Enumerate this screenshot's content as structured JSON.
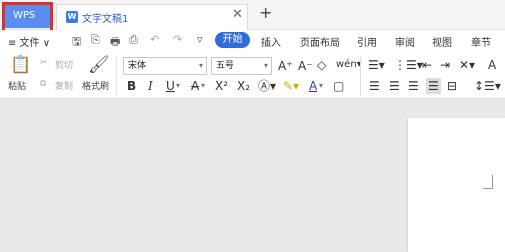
{
  "tabs": {
    "wps_label": "WPS",
    "doc_icon_letter": "W",
    "doc_title": "文字文稿1",
    "close_glyph": "✕",
    "new_tab_glyph": "+"
  },
  "menu": {
    "file_label": "≡ 文件 ∨",
    "quick_access": [
      "🖫",
      "⎘",
      "🖶",
      "⎙",
      "↶",
      "↷",
      "▿"
    ],
    "active_tab": "开始",
    "tabs": [
      "插入",
      "页面布局",
      "引用",
      "审阅",
      "视图",
      "章节"
    ]
  },
  "ribbon": {
    "paste_label": "粘贴",
    "cut_label": "剪切",
    "copy_label": "复制",
    "format_painter_label": "格式刷",
    "font_name": "宋体",
    "font_size": "五号",
    "font_grow_glyph": "A⁺",
    "font_shrink_glyph": "A⁻",
    "bold": "B",
    "italic": "I",
    "underline": "U",
    "strike": "A",
    "superscript": "X²",
    "subscript": "X₂",
    "font_color": "A"
  },
  "colors": {
    "accent": "#2f6ed8",
    "wps_tab": "#5b8def",
    "highlight_border": "#e0302a"
  }
}
